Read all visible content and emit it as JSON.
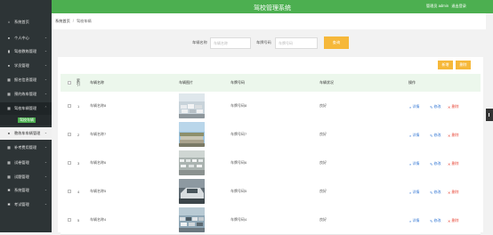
{
  "app": {
    "title": "驾校管理系统",
    "user_label": "管理员 admin",
    "logout": "退出登录"
  },
  "sidebar": {
    "items": [
      {
        "label": "系统首页",
        "icon": "home-icon",
        "has_chevron": false
      },
      {
        "label": "个人中心",
        "icon": "user-icon",
        "has_chevron": true
      },
      {
        "label": "驾校教练管理",
        "icon": "bookmark-icon",
        "has_chevron": true
      },
      {
        "label": "学员管理",
        "icon": "user-icon",
        "has_chevron": true
      },
      {
        "label": "报名信息管理",
        "icon": "grid-icon",
        "has_chevron": true
      },
      {
        "label": "预约练车管理",
        "icon": "grid-icon",
        "has_chevron": true
      },
      {
        "label": "驾校车辆管理",
        "icon": "grid-icon",
        "has_chevron": true
      },
      {
        "label": "教练车车辆管理",
        "icon": "grid-icon",
        "has_chevron": true
      },
      {
        "label": "补考费用管理",
        "icon": "grid-icon",
        "has_chevron": true
      },
      {
        "label": "试卷管理",
        "icon": "grid-icon",
        "has_chevron": true
      },
      {
        "label": "试题管理",
        "icon": "grid-icon",
        "has_chevron": true
      },
      {
        "label": "系统管理",
        "icon": "gear-icon",
        "has_chevron": true
      },
      {
        "label": "考试管理",
        "icon": "gear-icon",
        "has_chevron": true
      }
    ],
    "submenu_active": "驾校车辆"
  },
  "breadcrumb": {
    "home": "系统首页",
    "separator": "/",
    "current": "驾校车辆"
  },
  "search": {
    "name_label": "车辆名称",
    "name_placeholder": "车辆名称",
    "plate_label": "车牌号码",
    "plate_placeholder": "车牌号码",
    "button": "查询"
  },
  "toolbar": {
    "add": "新增",
    "delete": "删除"
  },
  "table": {
    "headers": {
      "index": "索引",
      "name": "车辆名称",
      "image": "车辆图片",
      "plate": "车牌号码",
      "status": "车辆状况",
      "actions": "操作"
    },
    "rows": [
      {
        "index": "1",
        "name": "车辆名称8",
        "plate": "车牌号码8",
        "status": "良好"
      },
      {
        "index": "2",
        "name": "车辆名称7",
        "plate": "车牌号码7",
        "status": "良好"
      },
      {
        "index": "3",
        "name": "车辆名称6",
        "plate": "车牌号码6",
        "status": "良好"
      },
      {
        "index": "4",
        "name": "车辆名称5",
        "plate": "车牌号码5",
        "status": "良好"
      },
      {
        "index": "5",
        "name": "车辆名称4",
        "plate": "车牌号码4",
        "status": "良好"
      }
    ],
    "actions": {
      "view": "详情",
      "edit": "修改",
      "delete": "删除"
    }
  },
  "colors": {
    "sidebar_bg": "#2d3436",
    "topbar_bg": "#4caf50",
    "header_row_bg": "#ecf7ec",
    "accent_button": "#f6b83a",
    "link_blue": "#3a7bd5",
    "delete_red": "#e84c3d"
  }
}
